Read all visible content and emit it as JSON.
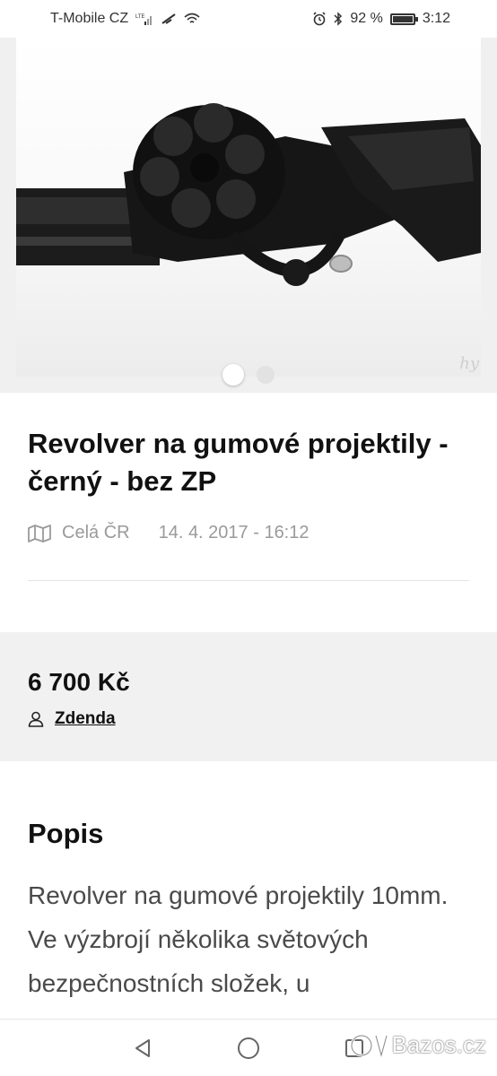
{
  "status_bar": {
    "carrier": "T-Mobile CZ",
    "network": "LTE",
    "battery_text": "92 %",
    "battery_level": 0.92,
    "time": "3:12"
  },
  "gallery": {
    "image_subject": "black revolver with rubber projectile",
    "watermark": "hy",
    "slide_count": 2,
    "active_slide": 1
  },
  "listing": {
    "title": "Revolver na gumové projektily - černý - bez ZP",
    "location": "Celá ČR",
    "date": "14. 4. 2017 - 16:12",
    "price": "6 700 Kč",
    "seller": "Zdenda"
  },
  "description": {
    "heading": "Popis",
    "text": "Revolver na gumové projektily 10mm. Ve výzbrojí několika světových bezpečnostních složek, u"
  },
  "brand": {
    "name": "Bazos.cz"
  },
  "icons": [
    "alarm-icon",
    "bluetooth-icon",
    "wifi-icon",
    "map-icon",
    "user-icon",
    "back-icon",
    "home-icon",
    "recents-icon"
  ]
}
